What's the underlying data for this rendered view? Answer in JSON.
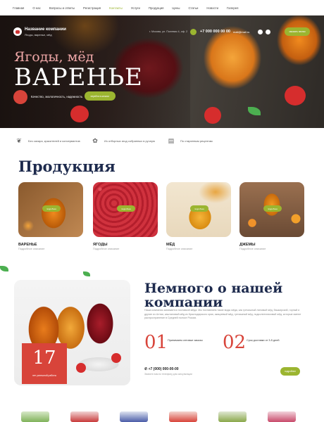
{
  "nav": {
    "items": [
      "Главная",
      "О нас",
      "Вопросы и ответы",
      "Регистрация",
      "Контакты",
      "Услуги",
      "Продукция",
      "Цены",
      "Статьи",
      "Новости",
      "Галерея"
    ],
    "active_index": 4
  },
  "header": {
    "company": "Название компании",
    "tagline": "Ягоды, варенье, мёд",
    "address": "г. Москва, ул. Полевая 4, оф. 2",
    "phone": "+7 000 000 00 00",
    "email": "mail@mail.ru",
    "call_button": "заказать звонок"
  },
  "hero": {
    "subtitle": "Ягоды, мёд",
    "title": "ВАРЕНЬЕ",
    "badge_text": "Качество, экологичность, надежность",
    "catalog_button": "перейти в каталог"
  },
  "features": [
    {
      "icon": "leaf-icon",
      "text": "Без сахара, красителей и консервантов"
    },
    {
      "icon": "berry-icon",
      "text": "Из отборных ягод собранных в ручную"
    },
    {
      "icon": "book-icon",
      "text": "По старинным рецептам"
    }
  ],
  "products": {
    "title": "Продукция",
    "badge": "подробнее",
    "items": [
      {
        "name": "ВАРЕНЬЕ",
        "sub": "Подробное описание"
      },
      {
        "name": "ЯГОДЫ",
        "sub": "Подробное описание"
      },
      {
        "name": "МЁД",
        "sub": "Подробное описание"
      },
      {
        "name": "ДЖЕМЫ",
        "sub": "Подробное описание"
      }
    ]
  },
  "about": {
    "title": "Немного о нашей компании",
    "text": "Наша компания занимается поставкой мёда. Мы поставляем такие виды мёда, как гречишный липовый мёд, башкирский, горный и другие из Алтая, каштановый мёд из Краснодарского края, акациевый мёд, гречишный мёд, подсолнечниковый мёд, которые имеют распространение в Средней полосе России.",
    "years": "17",
    "years_text": "лет успешной работы",
    "stats": [
      {
        "value": "01",
        "text": "Принимаем оптовые заказы"
      },
      {
        "value": "02",
        "text": "Срок доставки от 3-5 дней"
      }
    ],
    "phone": "+7 (000) 000-00-00",
    "phone_sub": "Звоните нам по телефону для консультации",
    "more_button": "подробнее"
  },
  "colors": {
    "accent": "#9bb530",
    "red": "#d8443a",
    "heading": "#1d2a4d"
  }
}
